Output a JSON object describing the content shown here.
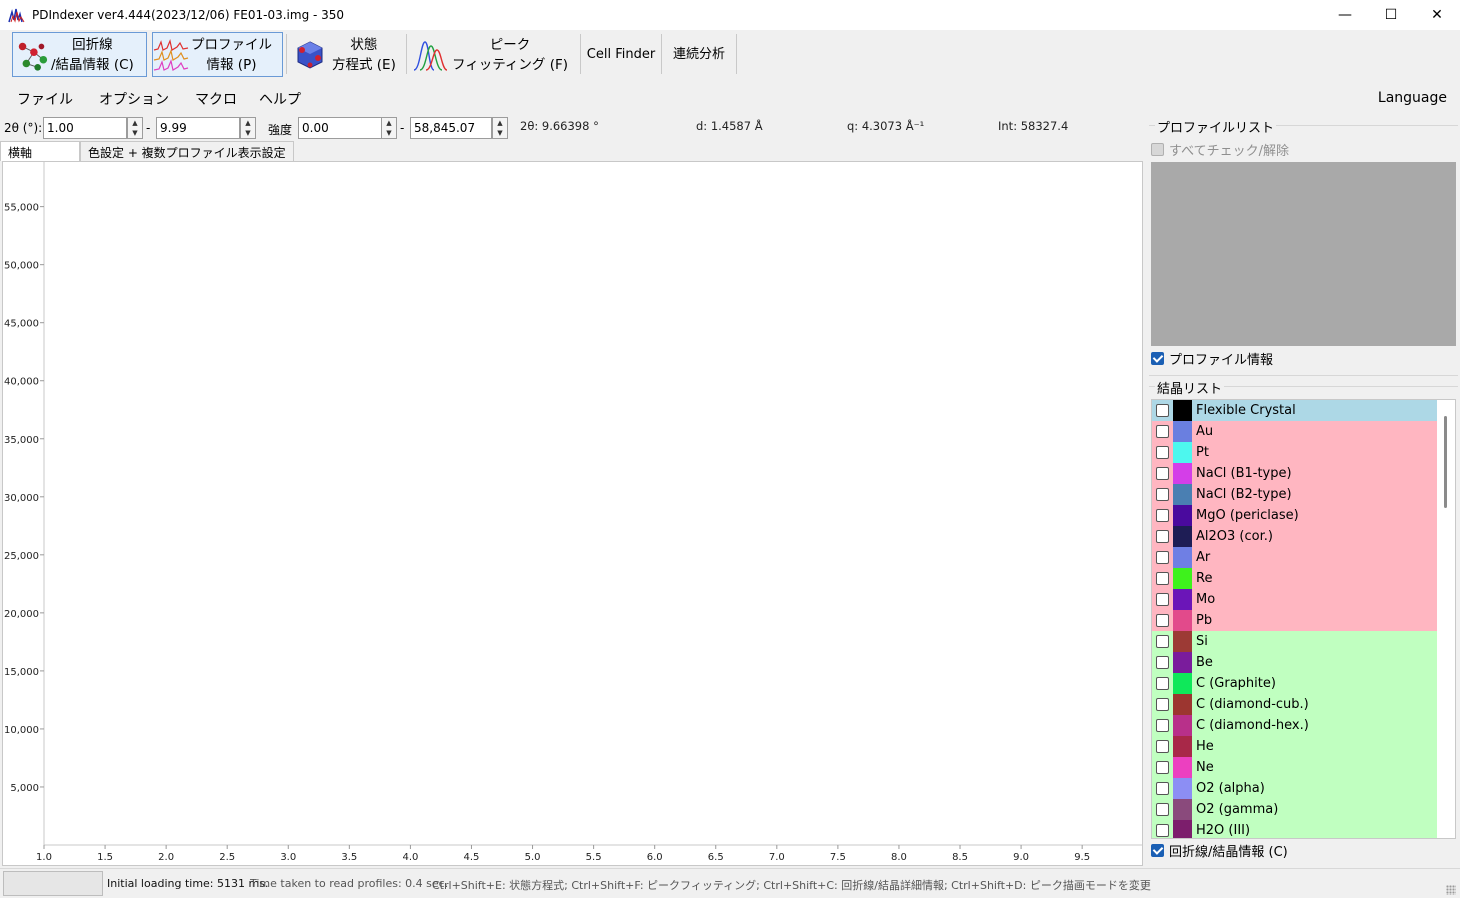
{
  "window": {
    "title": "PDIndexer   ver4.444(2023/12/06)   FE01-03.img - 350",
    "minimize": "—",
    "maximize": "☐",
    "close": "✕"
  },
  "toolbar": {
    "diffraction_label": "回折線\n/結晶情報 (C)",
    "profile_label": "プロファイル\n情報 (P)",
    "eos_label": "状態\n方程式 (E)",
    "peak_label": "ピーク\nフィッティング (F)",
    "cellfinder_label": "Cell Finder",
    "sequential_label": "連続分析"
  },
  "menu": {
    "file": "ファイル",
    "option": "オプション",
    "macro": "マクロ",
    "help": "ヘルプ",
    "language": "Language"
  },
  "range": {
    "twotheta_label": "2θ (°):",
    "twotheta_min": "1.00",
    "dash1": "-",
    "twotheta_max": "9.99",
    "intensity_label": "強度",
    "intensity_min": "0.00",
    "dash2": "-",
    "intensity_max": "58,845.07",
    "cursor_2theta": "2θ: 9.66398 °",
    "cursor_d": "d: 1.4587 Å",
    "cursor_q": "q: 4.3073 Å⁻¹",
    "cursor_int": "Int: 58327.4"
  },
  "tabs": {
    "axis": "横軸",
    "color": "色設定 + 複数プロファイル表示設定"
  },
  "chart_data": {
    "type": "line",
    "x_ticks": [
      "1.0",
      "1.5",
      "2.0",
      "2.5",
      "3.0",
      "3.5",
      "4.0",
      "4.5",
      "5.0",
      "5.5",
      "6.0",
      "6.5",
      "7.0",
      "7.5",
      "8.0",
      "8.5",
      "9.0",
      "9.5"
    ],
    "y_ticks": [
      "5,000",
      "10,000",
      "15,000",
      "20,000",
      "25,000",
      "30,000",
      "35,000",
      "40,000",
      "45,000",
      "50,000",
      "55,000"
    ],
    "xlim": [
      1.0,
      9.99
    ],
    "ylim": [
      0,
      58845.07
    ],
    "series": []
  },
  "profile_panel": {
    "title": "プロファイルリスト",
    "check_all": "すべてチェック/解除",
    "show_info": "プロファイル情報"
  },
  "crystal_panel": {
    "title": "結晶リスト",
    "footer": "回折線/結晶情報  (C)",
    "items": [
      {
        "name": "Flexible Crystal",
        "color": "#000000",
        "bg": "#add8e6"
      },
      {
        "name": "Au",
        "color": "#6a7fe0",
        "bg": "#ffb6c1"
      },
      {
        "name": "Pt",
        "color": "#4df7ee",
        "bg": "#ffb6c1"
      },
      {
        "name": "NaCl (B1-type)",
        "color": "#d43ee8",
        "bg": "#ffb6c1"
      },
      {
        "name": "NaCl (B2-type)",
        "color": "#4a7fb2",
        "bg": "#ffb6c1"
      },
      {
        "name": "MgO (periclase)",
        "color": "#4a0a9e",
        "bg": "#ffb6c1"
      },
      {
        "name": "Al2O3 (cor.)",
        "color": "#1e1d55",
        "bg": "#ffb6c1"
      },
      {
        "name": "Ar",
        "color": "#6f7fe4",
        "bg": "#ffb6c1"
      },
      {
        "name": "Re",
        "color": "#3ef21c",
        "bg": "#ffb6c1"
      },
      {
        "name": "Mo",
        "color": "#6b15b8",
        "bg": "#ffb6c1"
      },
      {
        "name": "Pb",
        "color": "#e24a8b",
        "bg": "#ffb6c1"
      },
      {
        "name": "Si",
        "color": "#9c3a35",
        "bg": "#c0ffc0"
      },
      {
        "name": "Be",
        "color": "#7a1c9c",
        "bg": "#c0ffc0"
      },
      {
        "name": "C (Graphite)",
        "color": "#0fe85a",
        "bg": "#c0ffc0"
      },
      {
        "name": "C (diamond-cub.)",
        "color": "#9c3630",
        "bg": "#c0ffc0"
      },
      {
        "name": "C (diamond-hex.)",
        "color": "#b8308a",
        "bg": "#c0ffc0"
      },
      {
        "name": "He",
        "color": "#a82848",
        "bg": "#c0ffc0"
      },
      {
        "name": "Ne",
        "color": "#ec40c0",
        "bg": "#c0ffc0"
      },
      {
        "name": "O2 (alpha)",
        "color": "#8c8ef4",
        "bg": "#c0ffc0"
      },
      {
        "name": "O2 (gamma)",
        "color": "#8a4a7c",
        "bg": "#c0ffc0"
      },
      {
        "name": "H2O (III)",
        "color": "#7c1e6c",
        "bg": "#c0ffc0"
      }
    ]
  },
  "status": {
    "loading": "Initial loading time: 5131 ms.",
    "read_time": "Time taken to read profiles: 0.4 sec.",
    "shortcuts": "Ctrl+Shift+E: 状態方程式; Ctrl+Shift+F: ピークフィッティング;   Ctrl+Shift+C: 回折線/結晶詳細情報;   Ctrl+Shift+D:  ピーク描画モードを変更"
  }
}
